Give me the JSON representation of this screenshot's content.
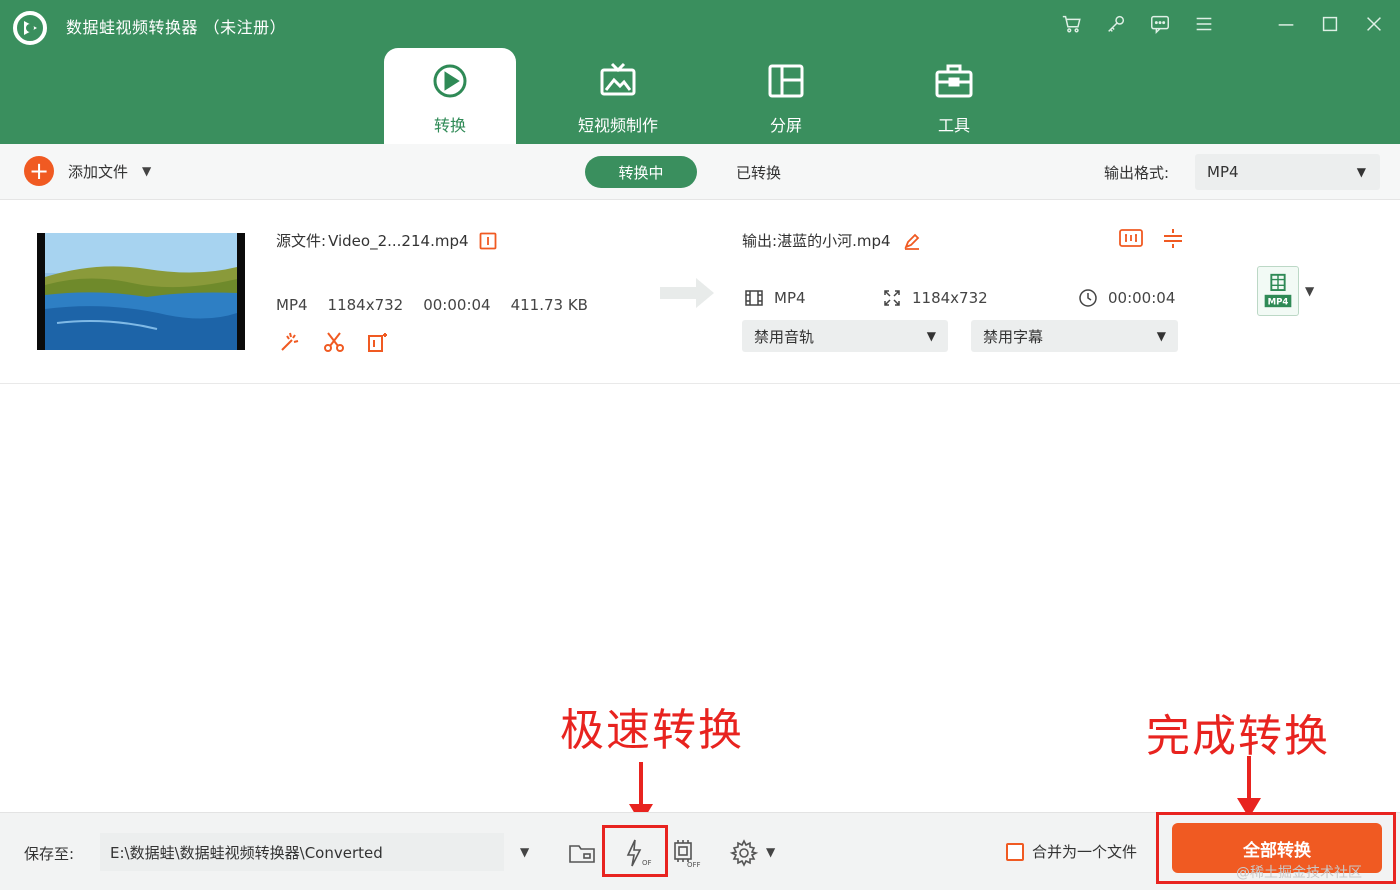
{
  "app": {
    "title": "数据蛙视频转换器 （未注册）"
  },
  "tabs": [
    {
      "label": "转换",
      "icon": "convert-icon",
      "active": true
    },
    {
      "label": "短视频制作",
      "icon": "tv-icon",
      "active": false
    },
    {
      "label": "分屏",
      "icon": "split-screen-icon",
      "active": false
    },
    {
      "label": "工具",
      "icon": "toolbox-icon",
      "active": false
    }
  ],
  "toolbar": {
    "add_file_label": "添加文件",
    "converting_label": "转换中",
    "converted_label": "已转换",
    "output_format_label": "输出格式:",
    "output_format_value": "MP4"
  },
  "file": {
    "source_label": "源文件:",
    "source_name": "Video_2...214.mp4",
    "format": "MP4",
    "resolution": "1184x732",
    "duration": "00:00:04",
    "size": "411.73 KB",
    "output_label": "输出:",
    "output_name": "湛蓝的小河.mp4",
    "out_format": "MP4",
    "out_resolution": "1184x732",
    "out_duration": "00:00:04",
    "audio_track": "禁用音轨",
    "subtitle": "禁用字幕",
    "badge_text": "MP4"
  },
  "annotations": {
    "fast_convert": "极速转换",
    "finish_convert": "完成转换"
  },
  "footer": {
    "save_label": "保存至:",
    "save_path": "E:\\数据蛙\\数据蛙视频转换器\\Converted",
    "merge_label": "合并为一个文件",
    "convert_all_label": "全部转换",
    "watermark": "@稀土掘金技术社区"
  },
  "colors": {
    "header_green": "#3a8f5e",
    "accent_orange": "#f05a22",
    "annotation_red": "#e8231f"
  }
}
